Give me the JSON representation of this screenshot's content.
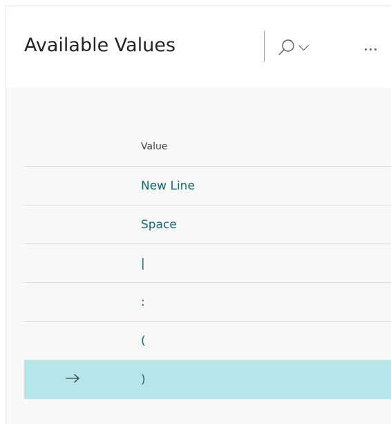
{
  "page": {
    "title": "Available Values"
  },
  "toolbar": {
    "search_icon": "search-icon",
    "dropdown_icon": "chevron-down-icon",
    "more_icon": "more-options-icon"
  },
  "table": {
    "column_header": "Value",
    "rows": [
      {
        "value": "New Line"
      },
      {
        "value": "Space"
      },
      {
        "value": "|"
      },
      {
        "value": ":"
      },
      {
        "value": "("
      },
      {
        "value": ")"
      }
    ],
    "selected_row_index": 5
  },
  "colors": {
    "accent_text": "#126a73",
    "selected_row": "#b6e5ea"
  }
}
